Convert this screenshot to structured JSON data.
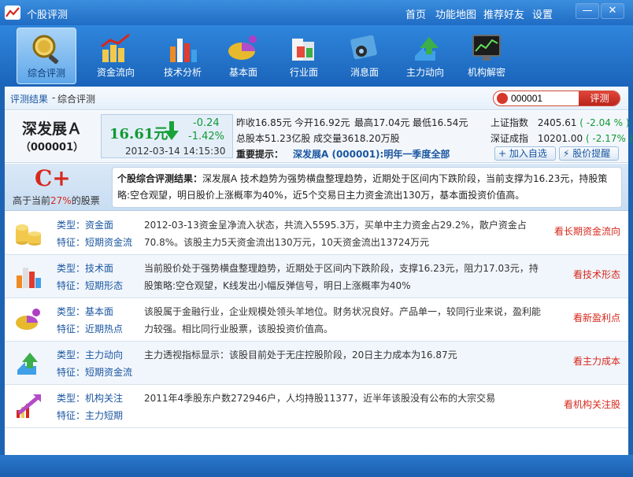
{
  "app": {
    "title": "个股评测"
  },
  "topnav": {
    "home": "首页",
    "sitemap": "功能地图",
    "recommend": "推荐好友",
    "settings": "设置"
  },
  "window": {
    "minimize": "—",
    "close": "✕"
  },
  "toolbar": {
    "items": [
      {
        "label": "综合评测",
        "icon": "magnifier-coin-icon"
      },
      {
        "label": "资金流向",
        "icon": "coins-chart-icon"
      },
      {
        "label": "技术分析",
        "icon": "bar-chart-icon"
      },
      {
        "label": "基本面",
        "icon": "pie-chart-icon"
      },
      {
        "label": "行业面",
        "icon": "blocks-icon"
      },
      {
        "label": "消息面",
        "icon": "satellite-icon"
      },
      {
        "label": "主力动向",
        "icon": "arrows-icon"
      },
      {
        "label": "机构解密",
        "icon": "monitor-chart-icon"
      }
    ]
  },
  "breadcrumb": {
    "root": "评测结果",
    "sep": "-",
    "current": "综合评测"
  },
  "search": {
    "value": "000001",
    "button": "评测"
  },
  "stock": {
    "name": "深发展Ａ",
    "code": "（000001）",
    "price": "16.61元",
    "change": "-0.24",
    "pct": "-1.42%",
    "time": "2012-03-14 14:15:30",
    "stats": {
      "prev_close": "昨收16.85元",
      "open": "今开16.92元",
      "high": "最高17.04元",
      "low": "最低16.54元",
      "total_equity": "总股本51.23亿股",
      "volume": "成交量3618.20万股"
    },
    "prompt_label": "重要提示：",
    "prompt_text": "深发展A (000001):明年一季度全部"
  },
  "indices": [
    {
      "name": "上证指数",
      "value": "2405.61",
      "change": "( -2.04 % )"
    },
    {
      "name": "深证成指",
      "value": "10201.00",
      "change": "( -2.17% )"
    }
  ],
  "buttons": {
    "add_watch": "加入自选",
    "price_alert": "股价提醒"
  },
  "rating": {
    "grade": "C+",
    "note_prefix": "高于当前",
    "note_pct": "27%",
    "note_suffix": "的股票",
    "summary_title": "个股综合评测结果：",
    "summary_text": "深发展A 技术趋势为强势横盘整理趋势，近期处于区间内下跌阶段，当前支撑为16.23元，持股策略:空仓观望，明日股价上涨概率为40%，近5个交易日主力资金流出130万，基本面投资价值高。"
  },
  "rows": [
    {
      "type_label": "类型：",
      "type": "资金面",
      "feature_label": "特征：",
      "feature": "短期资金流",
      "desc": "2012-03-13资金呈净流入状态，共流入5595.3万，买单中主力资金占29.2%，散户资金占70.8%。该股主力5天资金流出130万元，10天资金流出13724万元",
      "link": "看长期资金流向",
      "icon": "gold-coins-icon"
    },
    {
      "type_label": "类型：",
      "type": "技术面",
      "feature_label": "特征：",
      "feature": "短期形态",
      "desc": "当前股价处于强势横盘整理趋势，近期处于区间内下跌阶段，支撑16.23元，阻力17.03元，持股策略:空仓观望，K线发出小幅反弹信号，明日上涨概率为40%",
      "link": "看技术形态",
      "icon": "bar-chart-icon"
    },
    {
      "type_label": "类型：",
      "type": "基本面",
      "feature_label": "特征：",
      "feature": "近期热点",
      "desc": "该股属于金融行业，企业规模处领头羊地位。财务状况良好。产品单一，较同行业来说，盈利能力较强。相比同行业股票，该股投资价值高。",
      "link": "看新盈利点",
      "icon": "pie-chart-icon"
    },
    {
      "type_label": "类型：",
      "type": "主力动向",
      "feature_label": "特征：",
      "feature": "短期资金流",
      "desc": "主力透视指标显示：该股目前处于无庄控股阶段，20日主力成本为16.87元",
      "link": "看主力成本",
      "icon": "arrows-icon"
    },
    {
      "type_label": "类型：",
      "type": "机构关注",
      "feature_label": "特征：",
      "feature": "主力短期",
      "desc": "2011年4季股东户数272946户，人均持股11377，近半年该股没有公布的大宗交易",
      "link": "看机构关注股",
      "icon": "trend-arrow-icon"
    }
  ]
}
